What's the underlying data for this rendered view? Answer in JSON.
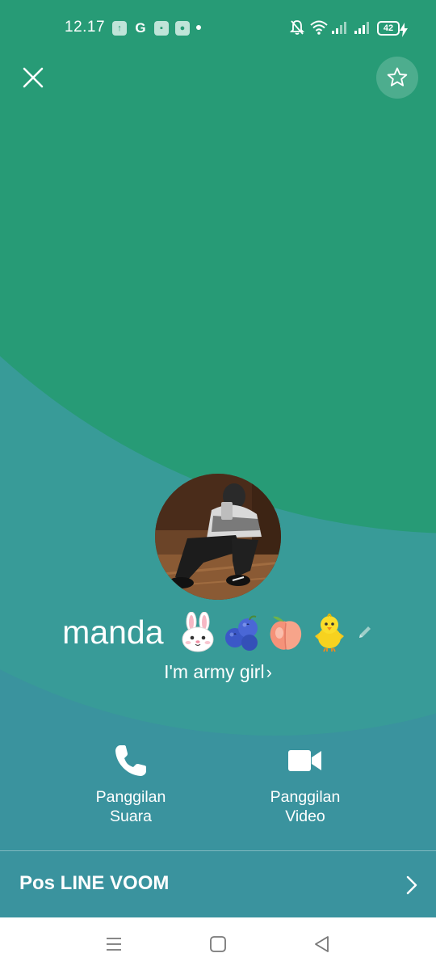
{
  "status_bar": {
    "time": "12.17",
    "battery": "42"
  },
  "profile": {
    "name": "manda",
    "emojis": [
      "rabbit-face",
      "blueberries",
      "peach",
      "baby-chick"
    ],
    "status_message": "I'm army girl",
    "status_chevron": "›"
  },
  "actions": {
    "voice_call": {
      "line1": "Panggilan",
      "line2": "Suara"
    },
    "video_call": {
      "line1": "Panggilan",
      "line2": "Video"
    }
  },
  "voom": {
    "label": "Pos LINE VOOM"
  },
  "colors": {
    "primary_green": "#279b76",
    "teal": "#3a939e",
    "mid_teal": "#389b98",
    "text": "#ffffff"
  }
}
